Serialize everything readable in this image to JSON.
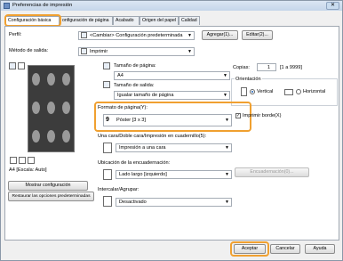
{
  "window": {
    "title": "Preferencias de impresión",
    "close": "✕"
  },
  "tabs": [
    "Configuración básica",
    "onfiguración de página",
    "Acabado",
    "Origen del papel",
    "Calidad"
  ],
  "profile": {
    "label": "Perfil:",
    "value": "<Cambiar> Configuración predeterminada",
    "add": "Agregar(1)...",
    "edit": "Editar(2)..."
  },
  "output": {
    "label": "Método de salida:",
    "value": "Imprimir"
  },
  "preview": {
    "scale_label": "A4 [Escala: Auto]"
  },
  "page_size": {
    "label": "Tamaño de página:",
    "value": "A4"
  },
  "output_size": {
    "label": "Tamaño de salida:",
    "value": "Igualar tamaño de página"
  },
  "copies": {
    "label": "Copias:",
    "value": "1",
    "range": "[1 a 9999]"
  },
  "orientation": {
    "label": "Orientación",
    "vertical": "Vertical",
    "horizontal": "Horizontal",
    "selected": "vertical"
  },
  "page_format": {
    "label": "Formato de página(Y):",
    "value": "Póster [3 x 3]",
    "badge": "9",
    "border_label": "Imprimir borde(X)",
    "border_checked": true
  },
  "duplex": {
    "label": "Una cara/Doble cara/Impresión en cuadernillo(5):",
    "value": "Impresión a una cara"
  },
  "binding": {
    "label": "Ubicación de la encuadernación:",
    "value": "Lado largo [izquierdo]",
    "button": "Encuadernación(0)..."
  },
  "collate": {
    "label": "Intercalar/Agrupar:",
    "value": "Desactivado"
  },
  "buttons": {
    "show_settings": "Mostrar configuración",
    "restore": "Restaurar las opciones predeterminadas",
    "accept": "Aceptar",
    "cancel": "Cancelar",
    "help": "Ayuda"
  },
  "colors": {
    "highlight": "#f0a030",
    "accent": "#1a5fb4"
  }
}
